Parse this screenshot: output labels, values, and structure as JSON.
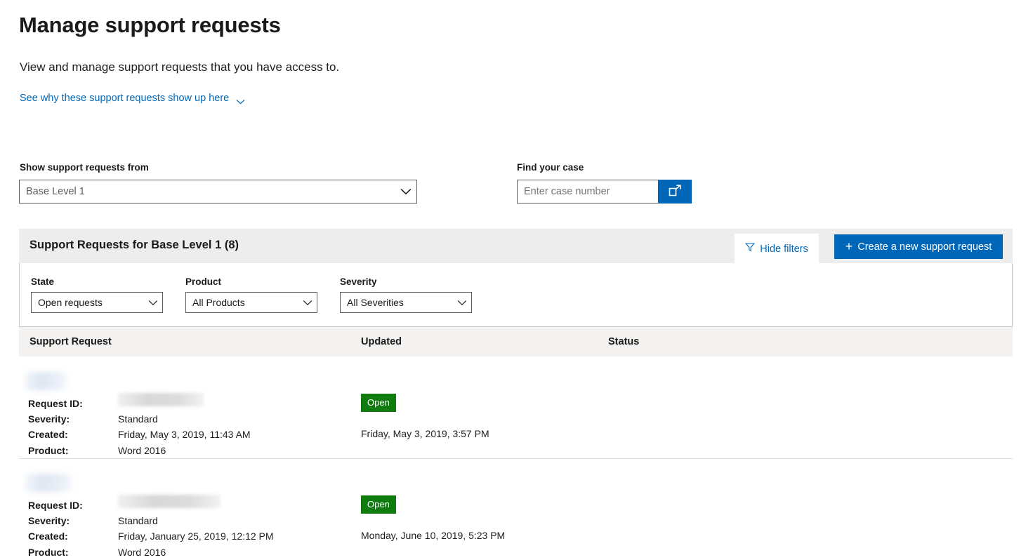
{
  "page": {
    "title": "Manage support requests",
    "subtitle": "View and manage support requests that you have access to.",
    "why_link": "See why these support requests show up here"
  },
  "topfilters": {
    "show_from_label": "Show support requests from",
    "show_from_value": "Base Level 1",
    "find_case_label": "Find your case",
    "find_case_placeholder": "Enter case number",
    "find_case_value": "",
    "find_case_button_icon": "open-in-new-window-icon"
  },
  "panel": {
    "title": "Support Requests for Base Level 1 (8)",
    "hide_filters_label": "Hide filters",
    "hide_filters_icon": "funnel-icon",
    "create_label": "Create a new support request",
    "create_icon": "plus-icon"
  },
  "filters": [
    {
      "label": "State",
      "value": "Open requests"
    },
    {
      "label": "Product",
      "value": "All Products"
    },
    {
      "label": "Severity",
      "value": "All Severities"
    }
  ],
  "table": {
    "columns": [
      "Support Request",
      "Updated",
      "Status"
    ],
    "keys": {
      "request_id": "Request ID:",
      "severity": "Severity:",
      "created": "Created:",
      "product": "Product:"
    },
    "rows": [
      {
        "title": "",
        "request_id": "",
        "severity": "Standard",
        "created": "Friday, May 3, 2019, 11:43 AM",
        "product": "Word 2016",
        "status": "Open",
        "updated": "Friday, May 3, 2019, 3:57 PM"
      },
      {
        "title": "",
        "request_id": "",
        "severity": "Standard",
        "created": "Friday, January 25, 2019, 12:12 PM",
        "product": "Word 2016",
        "status": "Open",
        "updated": "Monday, June 10, 2019, 5:23 PM"
      }
    ]
  },
  "colors": {
    "accent": "#0067b8",
    "link": "#0067b8",
    "status_open": "#107c10",
    "panel_header_bg": "#ededed",
    "table_header_bg": "#f3f2f1"
  }
}
